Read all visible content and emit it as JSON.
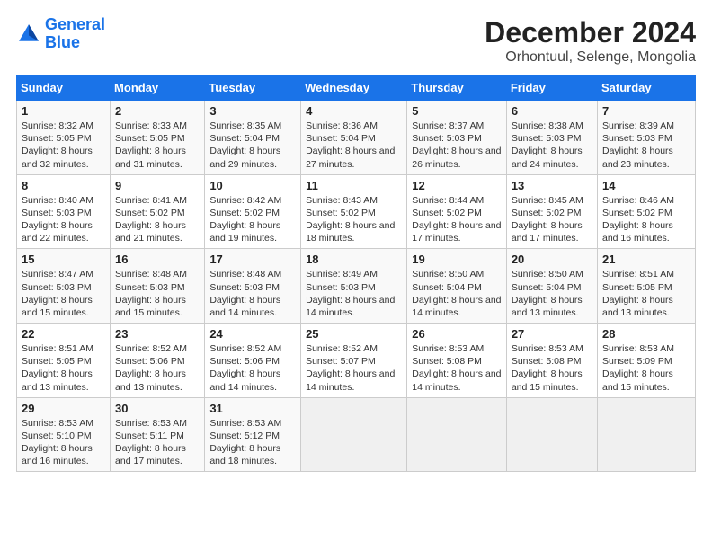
{
  "header": {
    "logo_general": "General",
    "logo_blue": "Blue",
    "main_title": "December 2024",
    "subtitle": "Orhontuul, Selenge, Mongolia"
  },
  "columns": [
    "Sunday",
    "Monday",
    "Tuesday",
    "Wednesday",
    "Thursday",
    "Friday",
    "Saturday"
  ],
  "weeks": [
    [
      {
        "day": "1",
        "sunrise": "Sunrise: 8:32 AM",
        "sunset": "Sunset: 5:05 PM",
        "daylight": "Daylight: 8 hours and 32 minutes."
      },
      {
        "day": "2",
        "sunrise": "Sunrise: 8:33 AM",
        "sunset": "Sunset: 5:05 PM",
        "daylight": "Daylight: 8 hours and 31 minutes."
      },
      {
        "day": "3",
        "sunrise": "Sunrise: 8:35 AM",
        "sunset": "Sunset: 5:04 PM",
        "daylight": "Daylight: 8 hours and 29 minutes."
      },
      {
        "day": "4",
        "sunrise": "Sunrise: 8:36 AM",
        "sunset": "Sunset: 5:04 PM",
        "daylight": "Daylight: 8 hours and 27 minutes."
      },
      {
        "day": "5",
        "sunrise": "Sunrise: 8:37 AM",
        "sunset": "Sunset: 5:03 PM",
        "daylight": "Daylight: 8 hours and 26 minutes."
      },
      {
        "day": "6",
        "sunrise": "Sunrise: 8:38 AM",
        "sunset": "Sunset: 5:03 PM",
        "daylight": "Daylight: 8 hours and 24 minutes."
      },
      {
        "day": "7",
        "sunrise": "Sunrise: 8:39 AM",
        "sunset": "Sunset: 5:03 PM",
        "daylight": "Daylight: 8 hours and 23 minutes."
      }
    ],
    [
      {
        "day": "8",
        "sunrise": "Sunrise: 8:40 AM",
        "sunset": "Sunset: 5:03 PM",
        "daylight": "Daylight: 8 hours and 22 minutes."
      },
      {
        "day": "9",
        "sunrise": "Sunrise: 8:41 AM",
        "sunset": "Sunset: 5:02 PM",
        "daylight": "Daylight: 8 hours and 21 minutes."
      },
      {
        "day": "10",
        "sunrise": "Sunrise: 8:42 AM",
        "sunset": "Sunset: 5:02 PM",
        "daylight": "Daylight: 8 hours and 19 minutes."
      },
      {
        "day": "11",
        "sunrise": "Sunrise: 8:43 AM",
        "sunset": "Sunset: 5:02 PM",
        "daylight": "Daylight: 8 hours and 18 minutes."
      },
      {
        "day": "12",
        "sunrise": "Sunrise: 8:44 AM",
        "sunset": "Sunset: 5:02 PM",
        "daylight": "Daylight: 8 hours and 17 minutes."
      },
      {
        "day": "13",
        "sunrise": "Sunrise: 8:45 AM",
        "sunset": "Sunset: 5:02 PM",
        "daylight": "Daylight: 8 hours and 17 minutes."
      },
      {
        "day": "14",
        "sunrise": "Sunrise: 8:46 AM",
        "sunset": "Sunset: 5:02 PM",
        "daylight": "Daylight: 8 hours and 16 minutes."
      }
    ],
    [
      {
        "day": "15",
        "sunrise": "Sunrise: 8:47 AM",
        "sunset": "Sunset: 5:03 PM",
        "daylight": "Daylight: 8 hours and 15 minutes."
      },
      {
        "day": "16",
        "sunrise": "Sunrise: 8:48 AM",
        "sunset": "Sunset: 5:03 PM",
        "daylight": "Daylight: 8 hours and 15 minutes."
      },
      {
        "day": "17",
        "sunrise": "Sunrise: 8:48 AM",
        "sunset": "Sunset: 5:03 PM",
        "daylight": "Daylight: 8 hours and 14 minutes."
      },
      {
        "day": "18",
        "sunrise": "Sunrise: 8:49 AM",
        "sunset": "Sunset: 5:03 PM",
        "daylight": "Daylight: 8 hours and 14 minutes."
      },
      {
        "day": "19",
        "sunrise": "Sunrise: 8:50 AM",
        "sunset": "Sunset: 5:04 PM",
        "daylight": "Daylight: 8 hours and 14 minutes."
      },
      {
        "day": "20",
        "sunrise": "Sunrise: 8:50 AM",
        "sunset": "Sunset: 5:04 PM",
        "daylight": "Daylight: 8 hours and 13 minutes."
      },
      {
        "day": "21",
        "sunrise": "Sunrise: 8:51 AM",
        "sunset": "Sunset: 5:05 PM",
        "daylight": "Daylight: 8 hours and 13 minutes."
      }
    ],
    [
      {
        "day": "22",
        "sunrise": "Sunrise: 8:51 AM",
        "sunset": "Sunset: 5:05 PM",
        "daylight": "Daylight: 8 hours and 13 minutes."
      },
      {
        "day": "23",
        "sunrise": "Sunrise: 8:52 AM",
        "sunset": "Sunset: 5:06 PM",
        "daylight": "Daylight: 8 hours and 13 minutes."
      },
      {
        "day": "24",
        "sunrise": "Sunrise: 8:52 AM",
        "sunset": "Sunset: 5:06 PM",
        "daylight": "Daylight: 8 hours and 14 minutes."
      },
      {
        "day": "25",
        "sunrise": "Sunrise: 8:52 AM",
        "sunset": "Sunset: 5:07 PM",
        "daylight": "Daylight: 8 hours and 14 minutes."
      },
      {
        "day": "26",
        "sunrise": "Sunrise: 8:53 AM",
        "sunset": "Sunset: 5:08 PM",
        "daylight": "Daylight: 8 hours and 14 minutes."
      },
      {
        "day": "27",
        "sunrise": "Sunrise: 8:53 AM",
        "sunset": "Sunset: 5:08 PM",
        "daylight": "Daylight: 8 hours and 15 minutes."
      },
      {
        "day": "28",
        "sunrise": "Sunrise: 8:53 AM",
        "sunset": "Sunset: 5:09 PM",
        "daylight": "Daylight: 8 hours and 15 minutes."
      }
    ],
    [
      {
        "day": "29",
        "sunrise": "Sunrise: 8:53 AM",
        "sunset": "Sunset: 5:10 PM",
        "daylight": "Daylight: 8 hours and 16 minutes."
      },
      {
        "day": "30",
        "sunrise": "Sunrise: 8:53 AM",
        "sunset": "Sunset: 5:11 PM",
        "daylight": "Daylight: 8 hours and 17 minutes."
      },
      {
        "day": "31",
        "sunrise": "Sunrise: 8:53 AM",
        "sunset": "Sunset: 5:12 PM",
        "daylight": "Daylight: 8 hours and 18 minutes."
      },
      null,
      null,
      null,
      null
    ]
  ]
}
